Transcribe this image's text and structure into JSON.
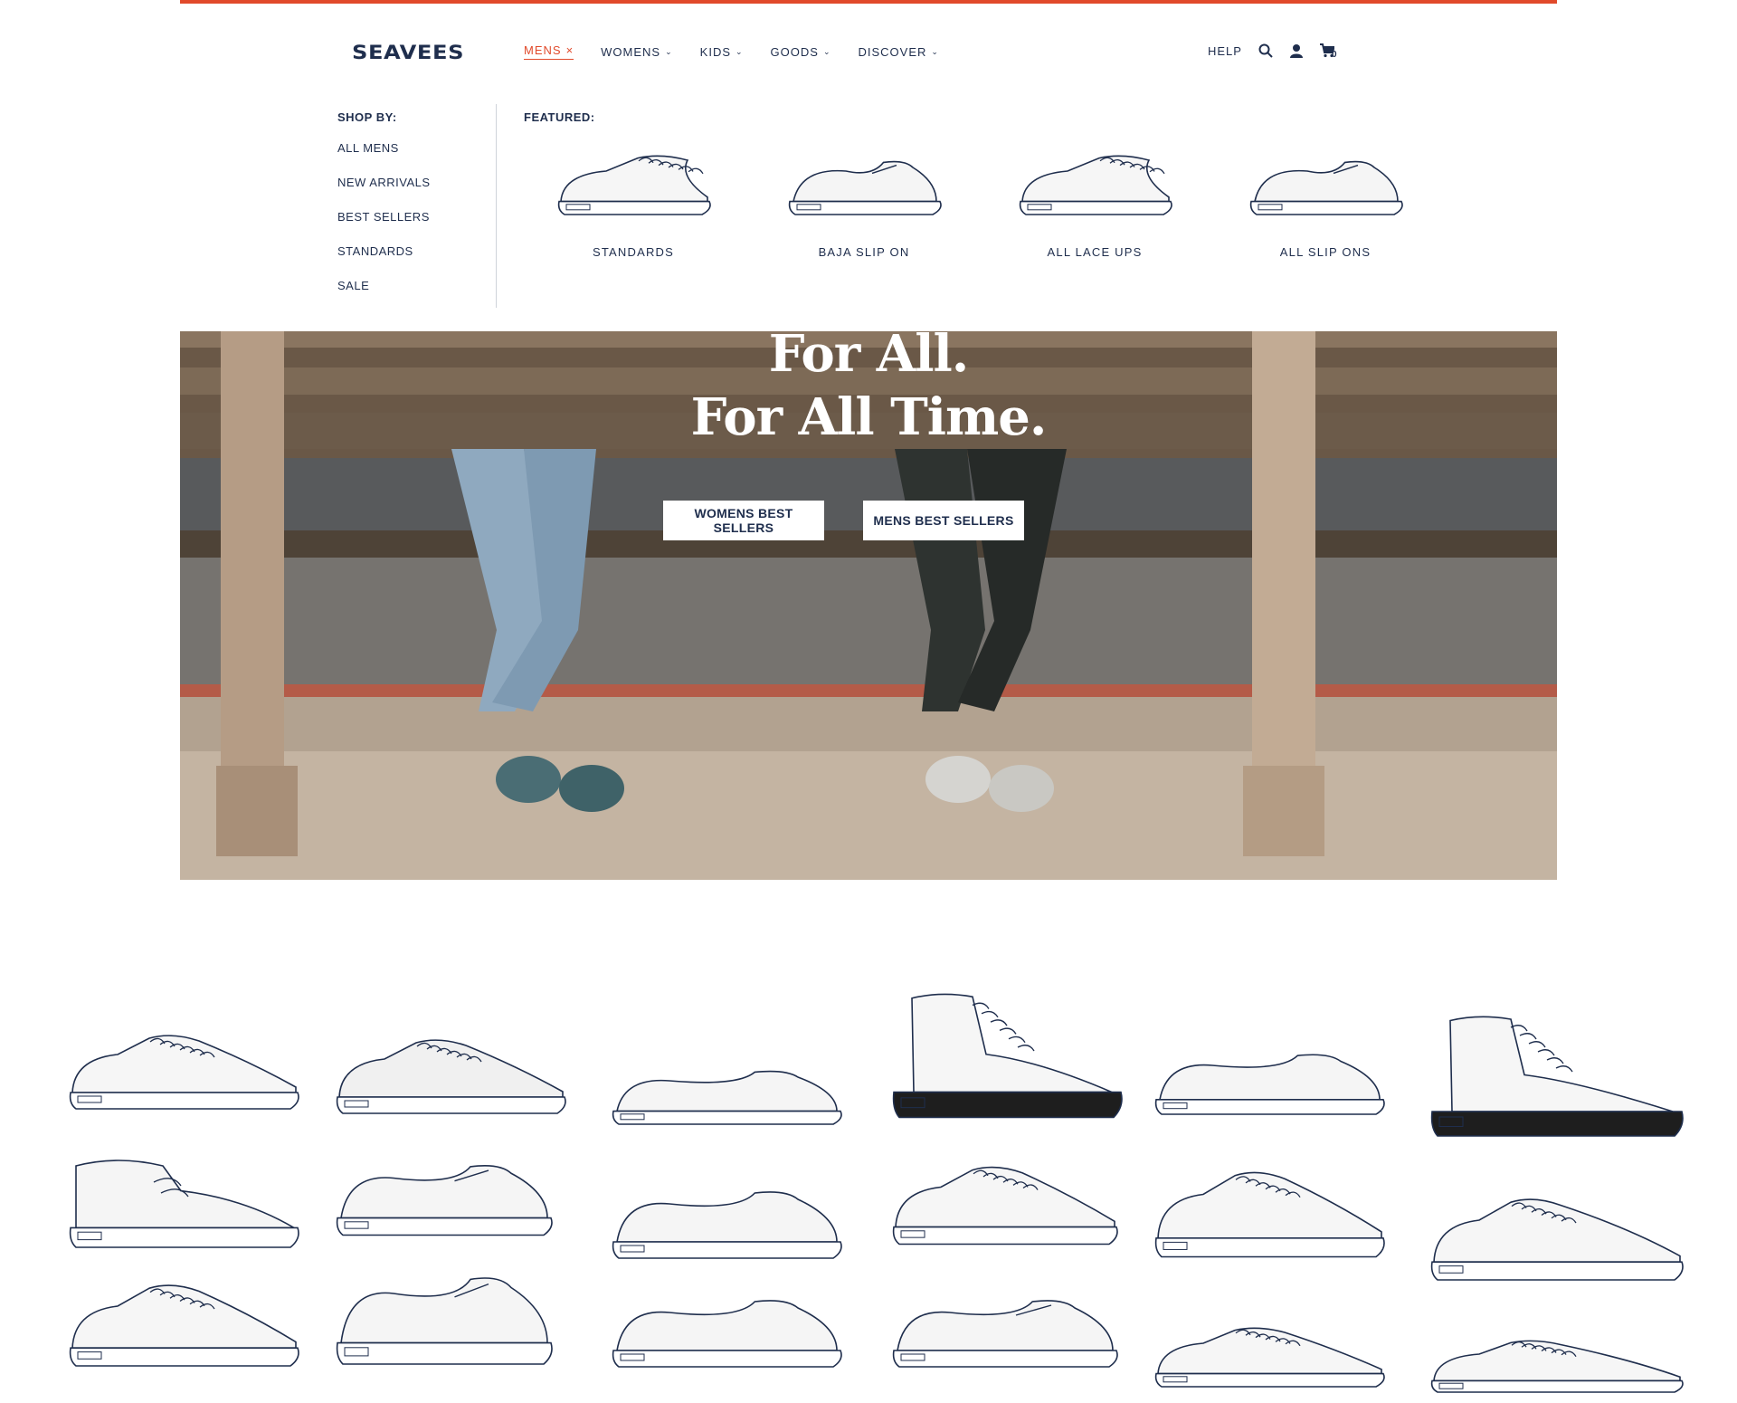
{
  "brand": {
    "logo_text": "SEAVEES",
    "accent": "#e14a2b",
    "navy": "#1f2e4d"
  },
  "nav": {
    "items": [
      {
        "label": "MENS",
        "marker": "×",
        "active": true
      },
      {
        "label": "WOMENS",
        "marker": "⌄",
        "active": false
      },
      {
        "label": "KIDS",
        "marker": "⌄",
        "active": false
      },
      {
        "label": "GOODS",
        "marker": "⌄",
        "active": false
      },
      {
        "label": "DISCOVER",
        "marker": "⌄",
        "active": false
      }
    ],
    "help_label": "HELP",
    "cart_count": "0",
    "icons": [
      "search-icon",
      "account-icon",
      "cart-icon"
    ]
  },
  "menu": {
    "shop_by_heading": "SHOP BY:",
    "shop_by_links": [
      "ALL MENS",
      "NEW ARRIVALS",
      "BEST SELLERS",
      "STANDARDS",
      "SALE"
    ],
    "featured_heading": "FEATURED:",
    "featured": [
      {
        "label": "STANDARDS",
        "style": "lace"
      },
      {
        "label": "BAJA SLIP ON",
        "style": "slip"
      },
      {
        "label": "ALL LACE UPS",
        "style": "lace"
      },
      {
        "label": "ALL SLIP ONS",
        "style": "slip"
      }
    ]
  },
  "hero": {
    "title_line1": "For All.",
    "title_line2": "For All Time.",
    "buttons": [
      "WOMENS BEST SELLERS",
      "MENS BEST SELLERS"
    ]
  },
  "shoe_grid": {
    "style_rows": [
      [
        "lace",
        "lace-dark",
        "mule",
        "hightop",
        "espadrille",
        "hightop"
      ],
      [
        "chukka",
        "slip",
        "loafer",
        "lace",
        "lace",
        "lace"
      ],
      [
        "lace",
        "slip",
        "loafer",
        "slip",
        "lace",
        "lace"
      ]
    ]
  }
}
